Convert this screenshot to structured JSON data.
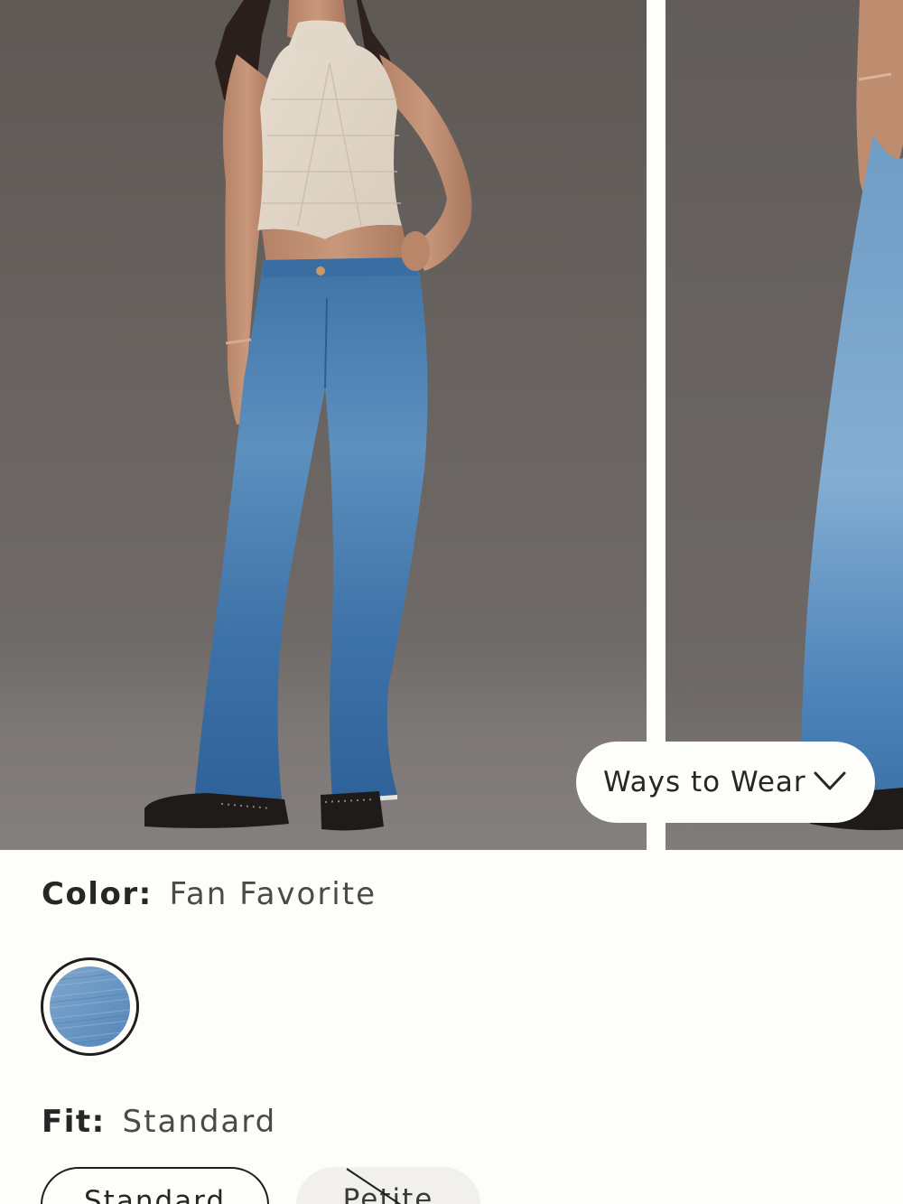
{
  "gallery": {
    "ways_to_wear_label": "Ways to Wear",
    "ways_to_wear_icon": "chevron-down-icon"
  },
  "color": {
    "label": "Color:",
    "value": "Fan Favorite",
    "swatches": [
      {
        "name": "Fan Favorite",
        "selected": true,
        "tone": "#6f9ac4"
      }
    ]
  },
  "fit": {
    "label": "Fit:",
    "value": "Standard",
    "options": [
      {
        "label": "Standard",
        "selected": true,
        "available": true
      },
      {
        "label": "Petite",
        "selected": false,
        "available": false
      }
    ]
  },
  "colors": {
    "background": "#fdfdf9",
    "studio_backdrop": "#6e6966",
    "denim": "#4f86ba",
    "text": "#262626"
  }
}
